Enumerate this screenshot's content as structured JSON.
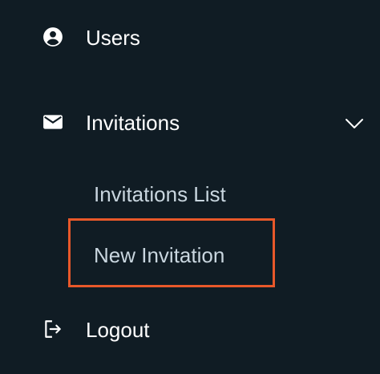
{
  "nav": {
    "users": {
      "label": "Users",
      "icon": "user-circle-icon"
    },
    "invitations": {
      "label": "Invitations",
      "icon": "envelope-icon",
      "expanded": true,
      "chevron": "chevron-down-icon",
      "children": [
        {
          "label": "Invitations List"
        },
        {
          "label": "New Invitation",
          "highlighted": true
        }
      ]
    },
    "logout": {
      "label": "Logout",
      "icon": "logout-icon"
    }
  },
  "colors": {
    "background": "#101c24",
    "text_primary": "#ffffff",
    "text_secondary": "#c9d6df",
    "highlight_border": "#e8582a"
  }
}
